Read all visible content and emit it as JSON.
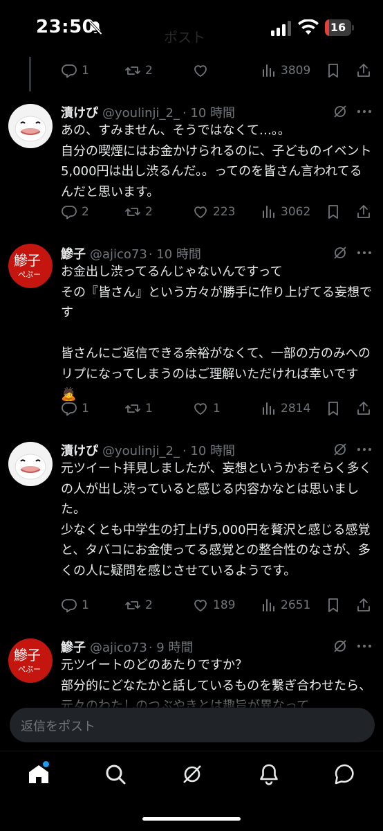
{
  "status": {
    "time": "23:50",
    "battery": "16",
    "battery_level": 0.16,
    "faded_title": "ポスト"
  },
  "top_actions": {
    "reply": "1",
    "repost": "2",
    "like": "",
    "views": "3809"
  },
  "tweets": [
    {
      "name": "漬けぴ",
      "handle": "@youlinji_2_",
      "time": "· 10 時間",
      "text": "あの、すみません、そうではなくて…。。\n自分の喫煙にはお金かけられるのに、子どものイベント5,000円は出し渋るんだ。。ってのを皆さん言われてるんだと思います。",
      "reply": "2",
      "repost": "2",
      "like": "223",
      "views": "3062"
    },
    {
      "name": "鰺子",
      "handle": "@ajico73",
      "time": "· 10 時間",
      "text": "お金出し渋ってるんじゃないんですって\nその『皆さん』という方々が勝手に作り上げてる妄想です\n\n皆さんにご返信できる余裕がなくて、一部の方のみへのリプになってしまうのはご理解いただければ幸いです🙇",
      "reply": "1",
      "repost": "1",
      "like": "1",
      "views": "2814"
    },
    {
      "name": "漬けぴ",
      "handle": "@youlinji_2_",
      "time": "· 10 時間",
      "text": "元ツイート拝見しましたが、妄想というかおそらく多くの人が出し渋っていると感じる内容かなとは思いました。\n少なくとも中学生の打上げ5,000円を贅沢と感じる感覚と、タバコにお金使ってる感覚との整合性のなさが、多くの人に疑問を感じさせているようです。",
      "reply": "1",
      "repost": "2",
      "like": "189",
      "views": "2651"
    },
    {
      "name": "鰺子",
      "handle": "@ajico73",
      "time": "· 9 時間",
      "text": "元ツイートのどのあたりですか？\n部分的にどなたかと話しているものを繋ぎ合わせたら、元々のわたしのつぶやきとは趣旨が異なって",
      "reply": "",
      "repost": "",
      "like": "",
      "views": ""
    }
  ],
  "reply_box": {
    "placeholder": "返信をポスト"
  },
  "avatar_text": {
    "ajico_top": "鰺子",
    "ajico_bottom": "ぺぷー"
  },
  "colors": {
    "background": "#000000",
    "text": "#e7e9ea",
    "muted": "#71767b",
    "accent": "#1d9bf0",
    "battery": "#e0413c"
  }
}
